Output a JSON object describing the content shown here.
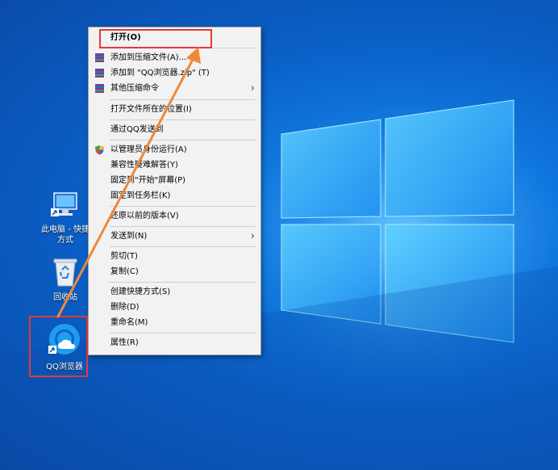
{
  "desktop": {
    "icons": [
      {
        "label": "此电脑 - 快捷方式",
        "name": "this-pc-shortcut"
      },
      {
        "label": "回收站",
        "name": "recycle-bin"
      },
      {
        "label": "QQ浏览器",
        "name": "qq-browser"
      }
    ]
  },
  "context_menu": {
    "items": [
      {
        "label": "打开(O)"
      },
      {
        "label": "添加到压缩文件(A)..."
      },
      {
        "label": "添加到 \"QQ浏览器.zip\" (T)"
      },
      {
        "label": "其他压缩命令"
      },
      {
        "label": "打开文件所在的位置(I)"
      },
      {
        "label": "通过QQ发送到"
      },
      {
        "label": "以管理员身份运行(A)"
      },
      {
        "label": "兼容性疑难解答(Y)"
      },
      {
        "label": "固定到\"开始\"屏幕(P)"
      },
      {
        "label": "固定到任务栏(K)"
      },
      {
        "label": "还原以前的版本(V)"
      },
      {
        "label": "发送到(N)"
      },
      {
        "label": "剪切(T)"
      },
      {
        "label": "复制(C)"
      },
      {
        "label": "创建快捷方式(S)"
      },
      {
        "label": "删除(D)"
      },
      {
        "label": "重命名(M)"
      },
      {
        "label": "属性(R)"
      }
    ]
  },
  "colors": {
    "highlight": "#e53935",
    "arrow": "#f0883a",
    "menu_bg": "#f2f2f2"
  }
}
